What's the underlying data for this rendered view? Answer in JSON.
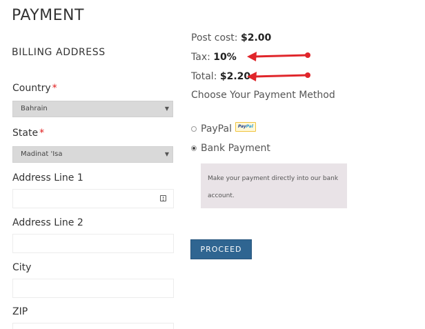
{
  "page": {
    "title": "PAYMENT"
  },
  "billing": {
    "section_title": "BILLING ADDRESS",
    "country": {
      "label": "Country",
      "required_mark": "*",
      "value": "Bahrain"
    },
    "state": {
      "label": "State",
      "required_mark": "*",
      "value": "Madinat 'Isa"
    },
    "address_line_1": {
      "label": "Address Line 1",
      "value": ""
    },
    "address_line_2": {
      "label": "Address Line 2",
      "value": ""
    },
    "city": {
      "label": "City",
      "value": ""
    },
    "zip": {
      "label": "ZIP",
      "value": ""
    },
    "select_chevron": "▼"
  },
  "summary": {
    "post_cost_label": "Post cost: ",
    "post_cost_value": "$2.00",
    "tax_label": "Tax: ",
    "tax_value": "10%",
    "total_label": "Total: ",
    "total_value": "$2.20"
  },
  "payment": {
    "choose_label": "Choose Your Payment Method",
    "paypal_label": "PayPal",
    "paypal_logo_pay": "Pay",
    "paypal_logo_pal": "Pal",
    "bank_label": "Bank Payment",
    "selected": "bank",
    "bank_description": "Make your payment directly into our bank account.",
    "proceed_label": "PROCEED"
  },
  "annotations": {
    "arrow_color": "#e0262b",
    "arrow_icon": "red-arrow-icon"
  },
  "colors": {
    "proceed_button": "#2f6591",
    "required_asterisk": "#e01b1b",
    "select_background": "#d9d9d9",
    "bank_info_background": "#e9e3e7"
  }
}
